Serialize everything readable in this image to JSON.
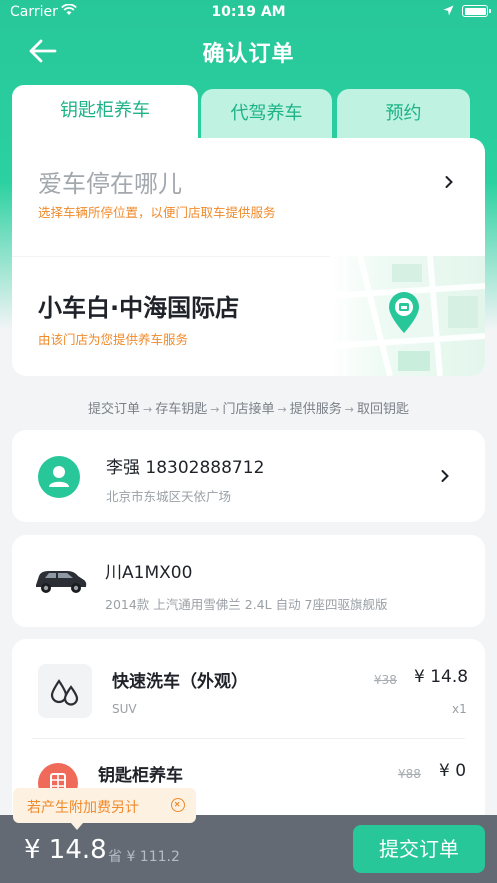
{
  "status_bar": {
    "carrier": "Carrier",
    "time": "10:19 AM"
  },
  "nav": {
    "title": "确认订单"
  },
  "tabs": [
    {
      "label": "钥匙柜养车",
      "active": true
    },
    {
      "label": "代驾养车",
      "active": false
    },
    {
      "label": "预约",
      "active": false
    }
  ],
  "location": {
    "title": "爱车停在哪儿",
    "subtitle": "选择车辆所停位置，以便门店取车提供服务"
  },
  "store": {
    "name": "小车白·中海国际店",
    "subtitle": "由该门店为您提供养车服务"
  },
  "steps": [
    "提交订单",
    "存车钥匙",
    "门店接单",
    "提供服务",
    "取回钥匙"
  ],
  "user": {
    "name_phone": "李强  18302888712",
    "address": "北京市东城区天依广场"
  },
  "car": {
    "plate": "川A1MX00",
    "model": "2014款 上汽通用雪佛兰 2.4L 自动 7座四驱旗舰版"
  },
  "services": [
    {
      "name": "快速洗车（外观）",
      "type": "SUV",
      "old_price": "¥38",
      "price": "¥ 14.8",
      "qty": "x1"
    },
    {
      "name": "钥匙柜养车",
      "old_price": "¥88",
      "price": "¥ 0"
    }
  ],
  "tooltip": {
    "text": "若产生附加费另计"
  },
  "footer": {
    "total": "¥ 14.8",
    "save": "省 ¥ 111.2",
    "submit_label": "提交订单"
  },
  "colors": {
    "accent": "#27c79a",
    "warning": "#f08a2b",
    "footer_bg": "#636a74"
  }
}
